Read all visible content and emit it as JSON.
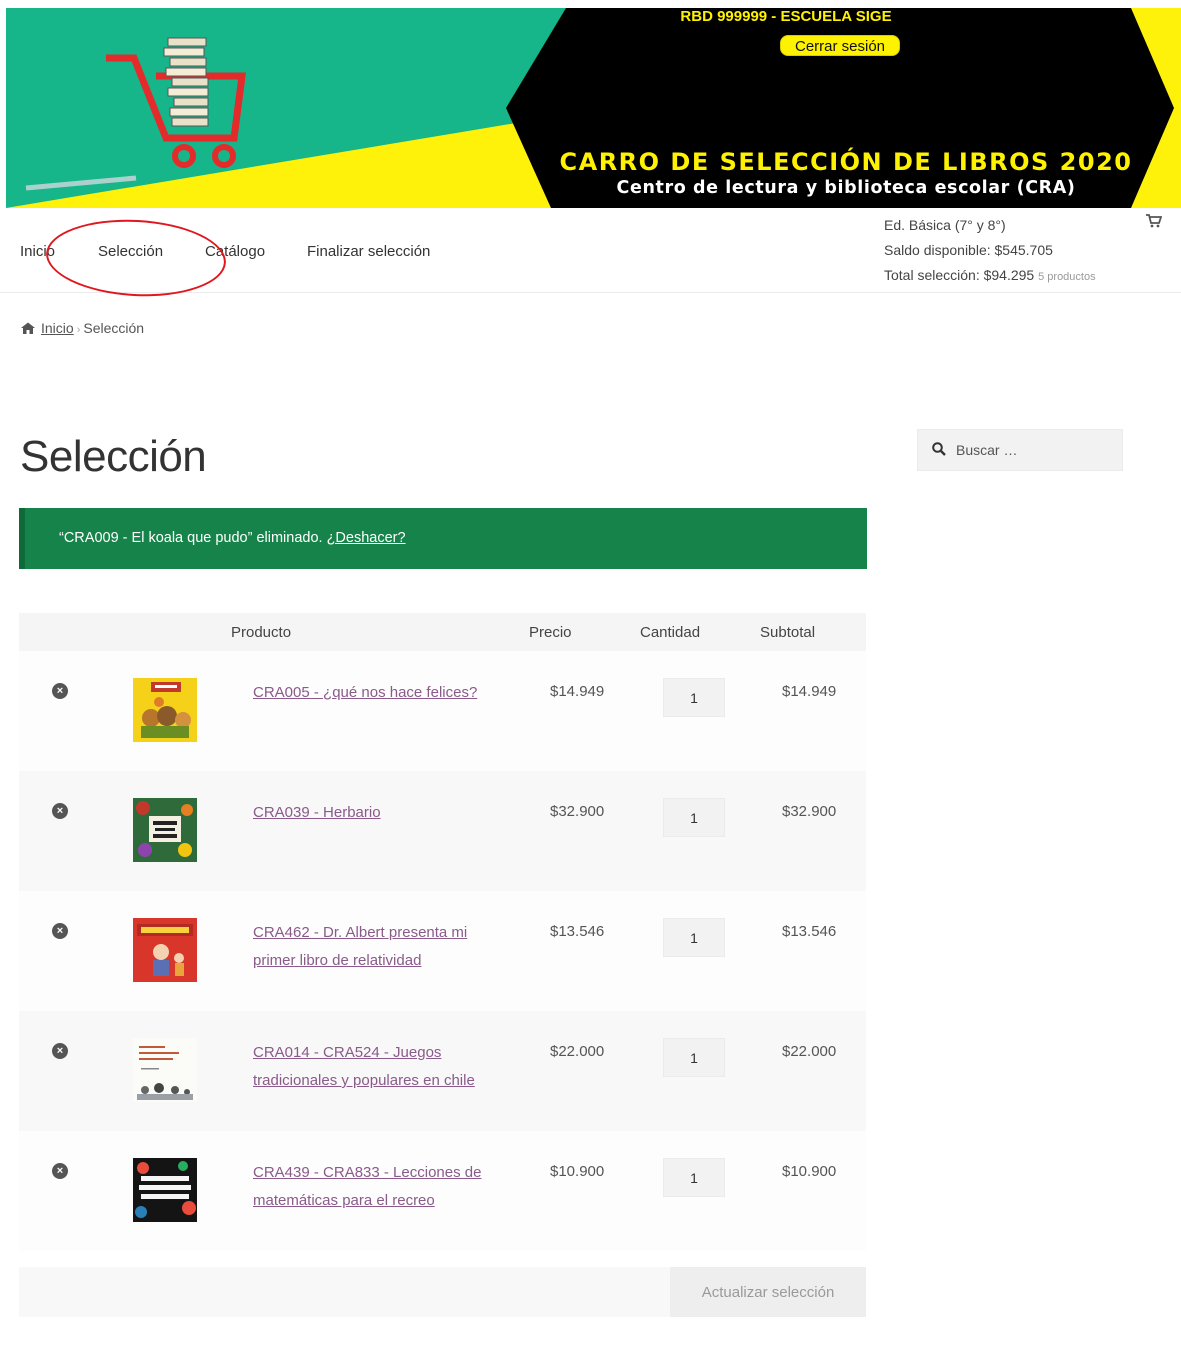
{
  "header": {
    "school": "RBD 999999 - ESCUELA SIGE",
    "logout_label": "Cerrar sesión",
    "banner_title": "CARRO DE SELECCIÓN DE LIBROS 2020",
    "banner_subtitle": "Centro de lectura y biblioteca escolar (CRA)"
  },
  "nav": {
    "items": [
      "Inicio",
      "Selección",
      "Catálogo",
      "Finalizar selección"
    ]
  },
  "cart": {
    "level": "Ed. Básica (7° y 8°)",
    "balance": "Saldo disponible: $545.705",
    "total": "Total selección: $94.295",
    "count": "5 productos"
  },
  "breadcrumb": {
    "home": "Inicio",
    "current": "Selección"
  },
  "page": {
    "title": "Selección"
  },
  "search": {
    "placeholder": "Buscar …"
  },
  "notice": {
    "text": "“CRA009 - El koala que pudo” eliminado.",
    "link": "¿Deshacer?"
  },
  "table": {
    "headers": {
      "product": "Producto",
      "price": "Precio",
      "quantity": "Cantidad",
      "subtotal": "Subtotal"
    },
    "rows": [
      {
        "name": "CRA005 - ¿qué nos hace felices?",
        "price": "$14.949",
        "qty": "1",
        "subtotal": "$14.949"
      },
      {
        "name": "CRA039 - Herbario",
        "price": "$32.900",
        "qty": "1",
        "subtotal": "$32.900"
      },
      {
        "name": "CRA462 - Dr. Albert presenta mi primer libro de relatividad",
        "price": "$13.546",
        "qty": "1",
        "subtotal": "$13.546"
      },
      {
        "name": "CRA014 - CRA524 - Juegos tradicionales y populares en chile",
        "price": "$22.000",
        "qty": "1",
        "subtotal": "$22.000"
      },
      {
        "name": "CRA439 - CRA833 - Lecciones de matemáticas para el recreo",
        "price": "$10.900",
        "qty": "1",
        "subtotal": "$10.900"
      }
    ]
  },
  "actions": {
    "update_label": "Actualizar selección"
  },
  "colors": {
    "notice_bg": "#16844a",
    "banner_yellow": "#fff20a",
    "banner_green": "#16b58a",
    "link_purple": "#8a5a8a"
  }
}
